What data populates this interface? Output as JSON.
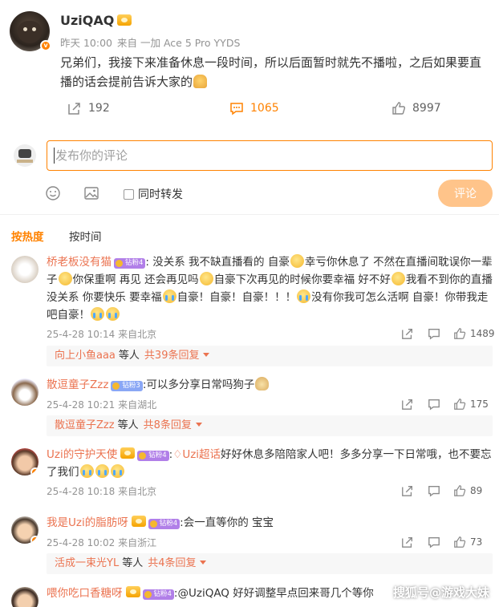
{
  "post": {
    "author": "UziQAQ",
    "time": "昨天 10:00",
    "source": "来自 一加 Ace 5 Pro YYDS",
    "content": "兄弟们，我接下来准备休息一段时间，所以后面暂时就先不播啦，之后如果要直播的话会提前告诉大家的",
    "share_count": "192",
    "comment_count": "1065",
    "like_count": "8997"
  },
  "comment_box": {
    "placeholder": "发布你的评论",
    "forward_label": "同时转发",
    "submit_label": "评论"
  },
  "sort": {
    "hot": "按热度",
    "time": "按时间"
  },
  "comments": [
    {
      "name": "桥老板没有猫",
      "badge": "钻粉4",
      "text_parts": [
        ": 没关系 我不缺直播看的 自豪",
        "幸亏你休息了 不然在直播间耽误你一辈子",
        "你保重啊 再见 还会再见吗",
        "自豪下次再见的时候你要幸福 好不好",
        "我看不到你的直播没关系 你要快乐 要幸福",
        "自豪！自豪！自豪！！！",
        "没有你我可怎么活啊 自豪！你带我走吧自豪！"
      ],
      "time": "25-4-28 10:14",
      "location": "来自北京",
      "likes": "1489",
      "reply_user": "向上小鱼aaa",
      "reply_etc": "等人",
      "reply_total": "共39条回复"
    },
    {
      "name": "散逗童子Zzz",
      "badge": "钻粉3",
      "text": ":可以多分享日常吗狗子",
      "time": "25-4-28 10:21",
      "location": "来自湖北",
      "likes": "175",
      "reply_user": "散逗童子Zzz",
      "reply_etc": "等人",
      "reply_total": "共8条回复"
    },
    {
      "name": "Uzi的守护天使",
      "badge": "钻粉4",
      "supertopic": "Uzi超话",
      "text": "好好休息多陪陪家人吧！多多分享一下日常哦，也不要忘了我们",
      "time": "25-4-28 10:18",
      "location": "来自北京",
      "likes": "89"
    },
    {
      "name": "我是Uzi的脂肪呀",
      "badge": "钻粉4",
      "text": ":会一直等你的 宝宝",
      "time": "25-4-28 10:02",
      "location": "来自浙江",
      "likes": "73",
      "reply_user": "活成一束光YL",
      "reply_etc": "等人",
      "reply_total": "共4条回复"
    },
    {
      "name": "喂你吃口香糖呀",
      "badge": "钻粉4",
      "text": ":@UziQAQ 好好调整早点回来哥几个等你"
    }
  ],
  "watermark": "搜狐号@游戏大妹",
  "colors": {
    "accent": "#ff8200",
    "name": "#eb7350",
    "muted": "#939393"
  }
}
